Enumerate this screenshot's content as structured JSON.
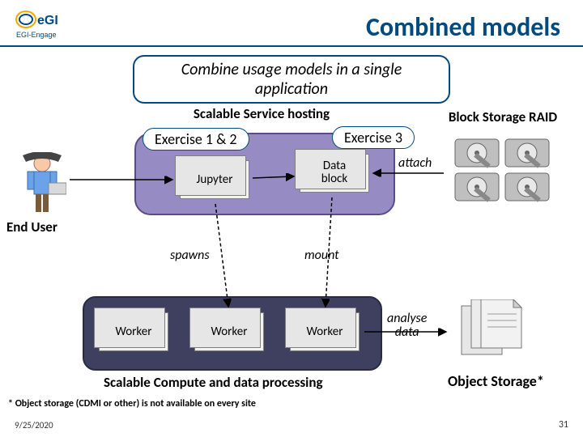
{
  "title": "Combined models",
  "subtitle": "Combine usage models in a single application",
  "labels": {
    "scalable_service": "Scalable Service hosting",
    "block_storage": "Block Storage RAID",
    "exercise12": "Exercise 1 & 2",
    "exercise3": "Exercise 3",
    "end_user": "End User",
    "scalable_compute": "Scalable Compute and data processing",
    "object_storage": "Object Storage*"
  },
  "nodes": {
    "jupyter": "Jupyter",
    "data_block": "Data\nblock",
    "worker": "Worker"
  },
  "arrows": {
    "spawns": "spawns",
    "mount": "mount",
    "attach": "attach",
    "analyse": "analyse\ndata"
  },
  "footnote": "* Object storage (CDMI or other) is not available on every site",
  "footer": {
    "date": "9/25/2020",
    "page": "31"
  },
  "logo": {
    "brand": "eGI",
    "sub": "EGI-Engage"
  }
}
